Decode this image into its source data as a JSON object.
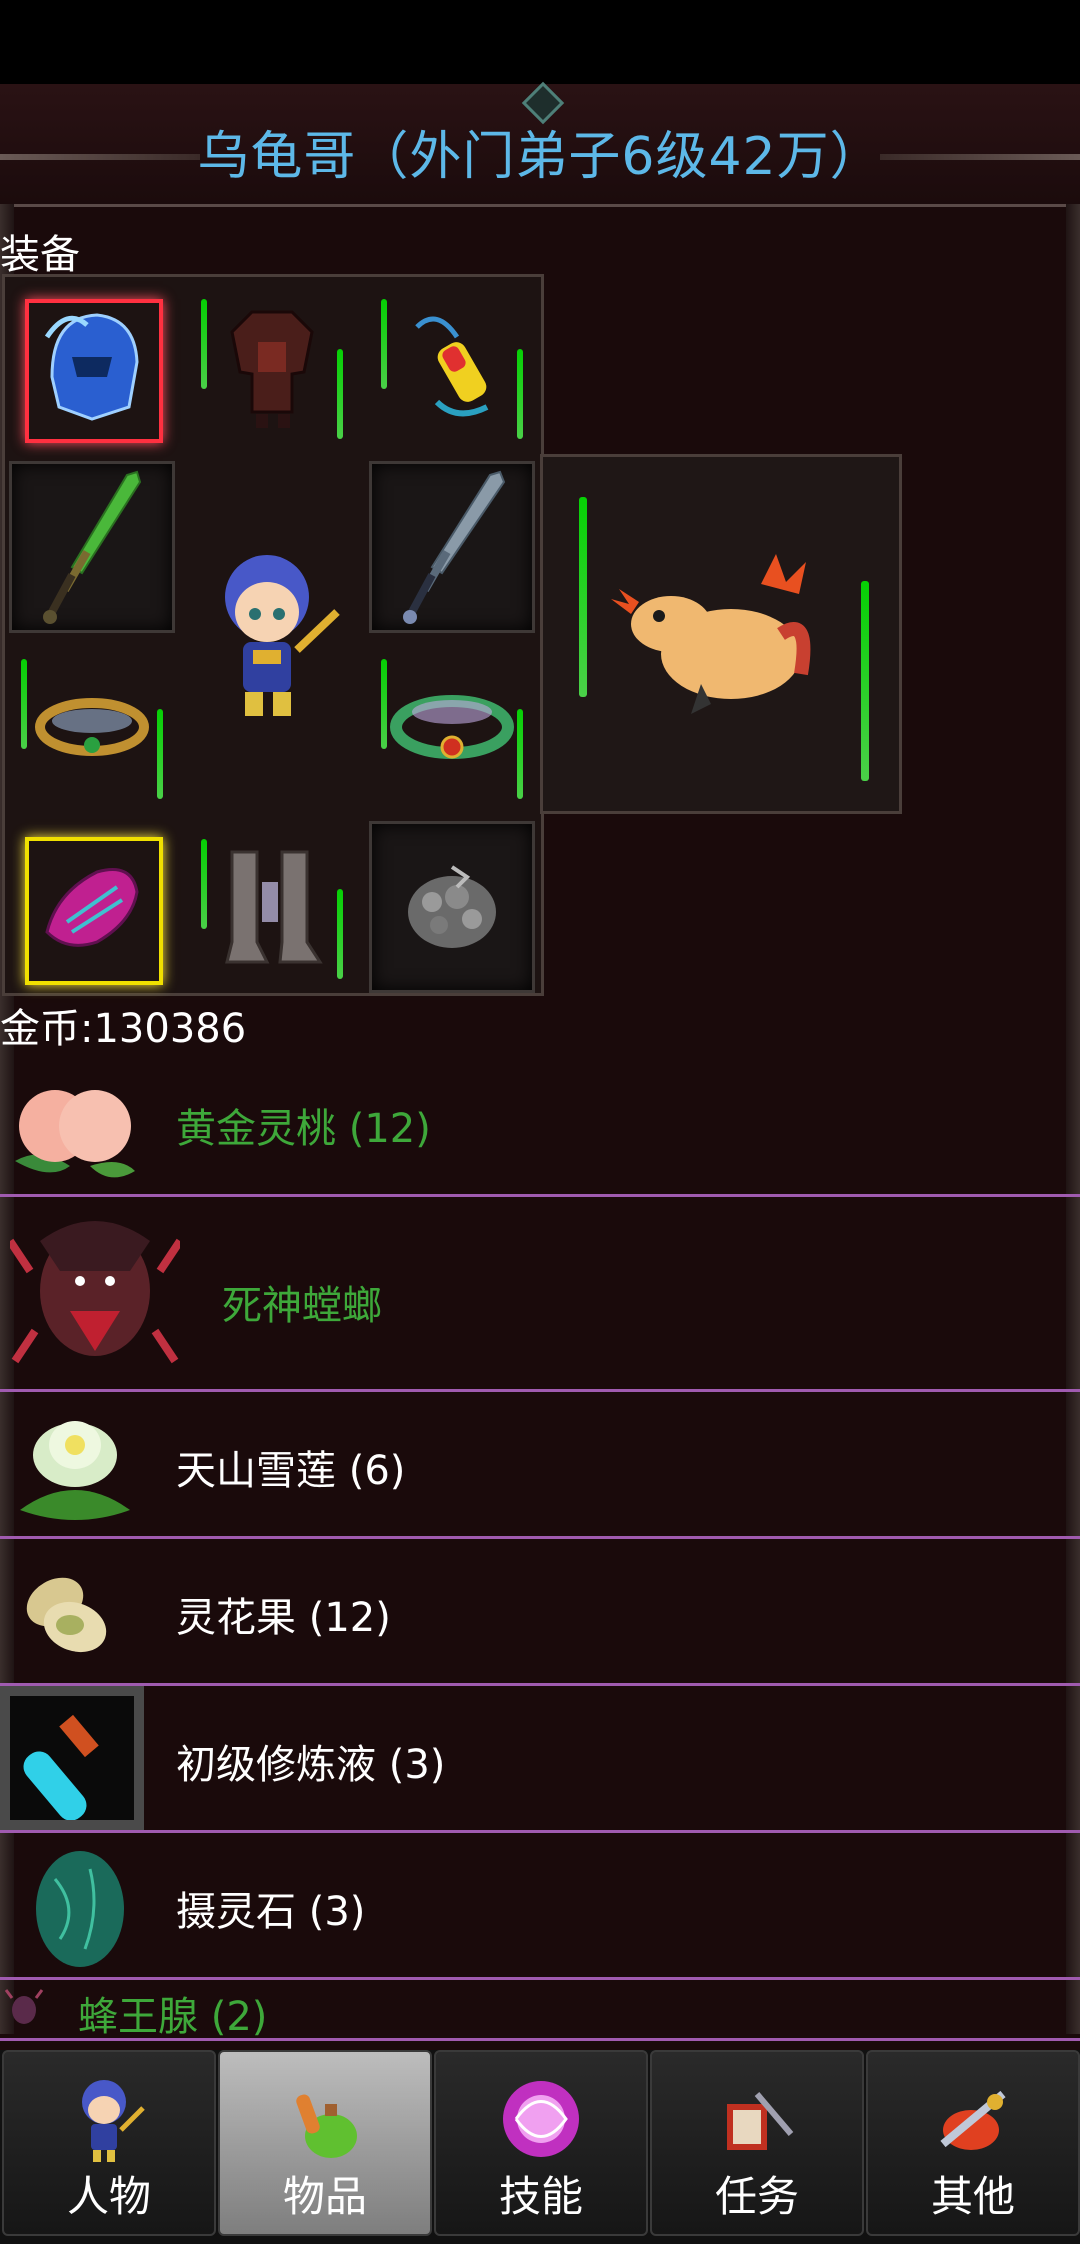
{
  "header": {
    "title": "乌龟哥（外门弟子6级42万）"
  },
  "equipment": {
    "label": "装备",
    "slots": [
      "helmet-icon",
      "armor-icon",
      "necklace-icon",
      "sword-left-icon",
      "sword-right-icon",
      "bracelet-left-icon",
      "bracelet-right-icon",
      "glove-icon",
      "boots-icon",
      "gem-icon"
    ],
    "pet": "pet-lizard-icon"
  },
  "gold": {
    "text": "金币:130386"
  },
  "items": [
    {
      "name": "黄金灵桃 (12)",
      "icon": "peach-icon"
    },
    {
      "name": "死神螳螂",
      "icon": "mantis-icon"
    },
    {
      "name": "天山雪莲 (6)",
      "icon": "lotus-icon"
    },
    {
      "name": "灵花果 (12)",
      "icon": "nut-icon"
    },
    {
      "name": "初级修炼液 (3)",
      "icon": "potion-icon"
    },
    {
      "name": "摄灵石 (3)",
      "icon": "green-stone-icon"
    },
    {
      "name": "蜂王腺 (2)",
      "icon": "bee-icon"
    }
  ],
  "nav": {
    "tabs": [
      {
        "label": "人物",
        "icon": "character-icon"
      },
      {
        "label": "物品",
        "icon": "bag-potion-icon"
      },
      {
        "label": "技能",
        "icon": "skill-orb-icon"
      },
      {
        "label": "任务",
        "icon": "quest-icon"
      },
      {
        "label": "其他",
        "icon": "other-icon"
      }
    ],
    "active": "物品"
  },
  "colors": {
    "title": "#5db8e8",
    "rare_item": "#3ea83a",
    "divider": "#a05bb0",
    "background": "#1a0a0b"
  }
}
